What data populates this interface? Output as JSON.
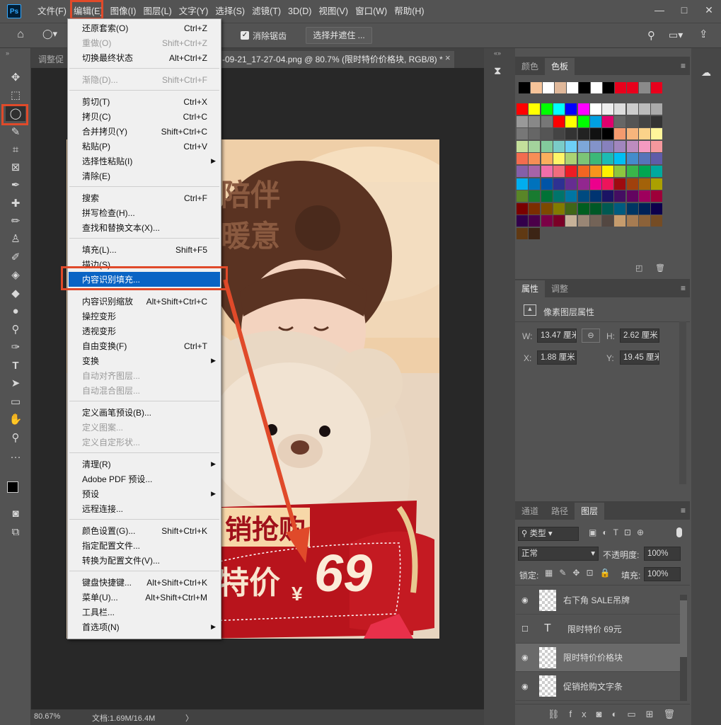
{
  "menubar": {
    "logo": "Ps",
    "items": [
      "文件(F)",
      "编辑(E)",
      "图像(I)",
      "图层(L)",
      "文字(Y)",
      "选择(S)",
      "滤镜(T)",
      "3D(D)",
      "视图(V)",
      "窗口(W)",
      "帮助(H)"
    ],
    "window_controls": [
      "—",
      "□",
      "✕"
    ]
  },
  "options_bar": {
    "antialias_label": "消除锯齿",
    "select_mask_button": "选择并遮住 ..."
  },
  "document_tab": {
    "left_fragment": "调整促",
    "title": "-09-21_17-27-04.png @ 80.7% (限时特价价格块, RGB/8) *",
    "close": "×"
  },
  "edit_menu": {
    "items": [
      {
        "label": "还原套索(O)",
        "shortcut": "Ctrl+Z",
        "disabled": false
      },
      {
        "label": "重做(O)",
        "shortcut": "Shift+Ctrl+Z",
        "disabled": true
      },
      {
        "label": "切换最终状态",
        "shortcut": "Alt+Ctrl+Z",
        "disabled": false
      },
      {
        "label": "渐隐(D)...",
        "shortcut": "Shift+Ctrl+F",
        "disabled": true
      },
      {
        "label": "剪切(T)",
        "shortcut": "Ctrl+X",
        "disabled": false
      },
      {
        "label": "拷贝(C)",
        "shortcut": "Ctrl+C",
        "disabled": false
      },
      {
        "label": "合并拷贝(Y)",
        "shortcut": "Shift+Ctrl+C",
        "disabled": false
      },
      {
        "label": "粘贴(P)",
        "shortcut": "Ctrl+V",
        "disabled": false
      },
      {
        "label": "选择性粘贴(I)",
        "shortcut": "",
        "disabled": false,
        "submenu": true
      },
      {
        "label": "清除(E)",
        "shortcut": "",
        "disabled": false
      },
      {
        "label": "搜索",
        "shortcut": "Ctrl+F",
        "disabled": false
      },
      {
        "label": "拼写检查(H)...",
        "shortcut": "",
        "disabled": false
      },
      {
        "label": "查找和替换文本(X)...",
        "shortcut": "",
        "disabled": false
      },
      {
        "label": "填充(L)...",
        "shortcut": "Shift+F5",
        "disabled": false
      },
      {
        "label": "描边(S)...",
        "shortcut": "",
        "disabled": false
      },
      {
        "label": "内容识别填充...",
        "shortcut": "",
        "disabled": false,
        "highlighted": true
      },
      {
        "label": "内容识别缩放",
        "shortcut": "Alt+Shift+Ctrl+C",
        "disabled": false
      },
      {
        "label": "操控变形",
        "shortcut": "",
        "disabled": false
      },
      {
        "label": "透视变形",
        "shortcut": "",
        "disabled": false
      },
      {
        "label": "自由变换(F)",
        "shortcut": "Ctrl+T",
        "disabled": false
      },
      {
        "label": "变换",
        "shortcut": "",
        "disabled": false,
        "submenu": true
      },
      {
        "label": "自动对齐图层...",
        "shortcut": "",
        "disabled": true
      },
      {
        "label": "自动混合图层...",
        "shortcut": "",
        "disabled": true
      },
      {
        "label": "定义画笔预设(B)...",
        "shortcut": "",
        "disabled": false
      },
      {
        "label": "定义图案...",
        "shortcut": "",
        "disabled": true
      },
      {
        "label": "定义自定形状...",
        "shortcut": "",
        "disabled": true
      },
      {
        "label": "清理(R)",
        "shortcut": "",
        "disabled": false,
        "submenu": true
      },
      {
        "label": "Adobe PDF 预设...",
        "shortcut": "",
        "disabled": false
      },
      {
        "label": "预设",
        "shortcut": "",
        "disabled": false,
        "submenu": true
      },
      {
        "label": "远程连接...",
        "shortcut": "",
        "disabled": false
      },
      {
        "label": "颜色设置(G)...",
        "shortcut": "Shift+Ctrl+K",
        "disabled": false
      },
      {
        "label": "指定配置文件...",
        "shortcut": "",
        "disabled": false
      },
      {
        "label": "转换为配置文件(V)...",
        "shortcut": "",
        "disabled": false
      },
      {
        "label": "键盘快捷键...",
        "shortcut": "Alt+Shift+Ctrl+K",
        "disabled": false
      },
      {
        "label": "菜单(U)...",
        "shortcut": "Alt+Shift+Ctrl+M",
        "disabled": false
      },
      {
        "label": "工具栏...",
        "shortcut": "",
        "disabled": false
      },
      {
        "label": "首选项(N)",
        "shortcut": "",
        "disabled": false,
        "submenu": true
      }
    ]
  },
  "canvas_text": {
    "headline1": "陪伴",
    "headline2": "暖意",
    "promo": "销抢购",
    "price_label": "特价",
    "currency": "¥",
    "price": "69"
  },
  "swatches_panel": {
    "tabs": [
      "颜色",
      "色板"
    ],
    "active_tab": "色板",
    "top_row": [
      "#000000",
      "#f6c49a",
      "#ffffff",
      "#e0b89a",
      "#ffffff",
      "#000000",
      "#ffffff",
      "#000000",
      "#e8001c",
      "#e8001c",
      "#8a8a8a",
      "#e8001c"
    ],
    "grid": [
      [
        "#ff0000",
        "#ffff00",
        "#00ff00",
        "#00ffff",
        "#0000ff",
        "#ff00ff",
        "#ffffff",
        "#eeeeee",
        "#dddddd",
        "#cccccc",
        "#bbbbbb",
        "#aaaaaa"
      ],
      [
        "#999999",
        "#888888",
        "#777777",
        "#ff0000",
        "#ffff00",
        "#00ff00",
        "#00a0e0",
        "#e0006e",
        "#666666",
        "#555555",
        "#444444",
        "#333333"
      ],
      [
        "#777777",
        "#666666",
        "#555555",
        "#444444",
        "#333333",
        "#222222",
        "#111111",
        "#000000",
        "#f49a6e",
        "#f7b57c",
        "#fbd38a",
        "#fff59a"
      ],
      [
        "#c4df9b",
        "#a3d39c",
        "#82ca9c",
        "#7accc8",
        "#6dcff6",
        "#7da7d9",
        "#8393ca",
        "#8781bd",
        "#a186be",
        "#bd8cbf",
        "#f49ac1",
        "#f5989d"
      ],
      [
        "#f26c4f",
        "#f68e56",
        "#fbaf5d",
        "#fff568",
        "#acd373",
        "#7cc576",
        "#3cb878",
        "#1cbbb4",
        "#00bff3",
        "#448ccb",
        "#5674b9",
        "#605ca8"
      ],
      [
        "#855fa8",
        "#a763a8",
        "#f06eaa",
        "#f26d7d",
        "#ed1c24",
        "#f26522",
        "#f7941d",
        "#fff200",
        "#8dc63f",
        "#39b54a",
        "#00a651",
        "#00a99d"
      ],
      [
        "#00aeef",
        "#0072bc",
        "#0054a6",
        "#2e3192",
        "#662d91",
        "#92278f",
        "#ec008c",
        "#ed145b",
        "#9e0b0f",
        "#a0410d",
        "#a36209",
        "#aba000"
      ],
      [
        "#598527",
        "#197b30",
        "#007236",
        "#00746b",
        "#0076a3",
        "#004a80",
        "#003471",
        "#1b1464",
        "#440e62",
        "#630460",
        "#9e005d",
        "#9e0039"
      ],
      [
        "#790000",
        "#7b2e00",
        "#7d4900",
        "#827b00",
        "#406618",
        "#005e20",
        "#005826",
        "#005952",
        "#005b7f",
        "#003663",
        "#002157",
        "#0d004c"
      ],
      [
        "#32004b",
        "#4b0049",
        "#7b0046",
        "#7a0026",
        "#c7b299",
        "#998675",
        "#736357",
        "#534741",
        "#c69c6d",
        "#a67c52",
        "#8c6239",
        "#754c24"
      ],
      [
        "#603913",
        "#3c2415"
      ]
    ]
  },
  "properties_panel": {
    "tabs": [
      "属性",
      "调整"
    ],
    "active_tab": "属性",
    "title": "像素图层属性",
    "w_label": "W:",
    "w_value": "13.47 厘米",
    "h_label": "H:",
    "h_value": "2.62 厘米",
    "x_label": "X:",
    "x_value": "1.88 厘米",
    "y_label": "Y:",
    "y_value": "19.45 厘米"
  },
  "layers_panel": {
    "tabs": [
      "通道",
      "路径",
      "图层"
    ],
    "active_tab": "图层",
    "filter_kind": "类型",
    "blend_mode": "正常",
    "opacity_label": "不透明度:",
    "opacity_value": "100%",
    "lock_label": "锁定:",
    "fill_label": "填充:",
    "fill_value": "100%",
    "layers": [
      {
        "name": "右下角 SALE吊牌",
        "type": "smart",
        "visible": true,
        "selected": false
      },
      {
        "name": "限时特价 69元",
        "type": "text",
        "visible": false,
        "selected": false
      },
      {
        "name": "限时特价价格块",
        "type": "pixel",
        "visible": true,
        "selected": true
      },
      {
        "name": "促销抢购文字条",
        "type": "smart",
        "visible": true,
        "selected": false
      }
    ]
  },
  "status_bar": {
    "zoom": "80.67%",
    "doc_info": "文档:1.69M/16.4M",
    "arrow": "〉"
  },
  "colors": {
    "menu_highlight": "#0a64c4",
    "annotation_red": "#e04a2a"
  }
}
